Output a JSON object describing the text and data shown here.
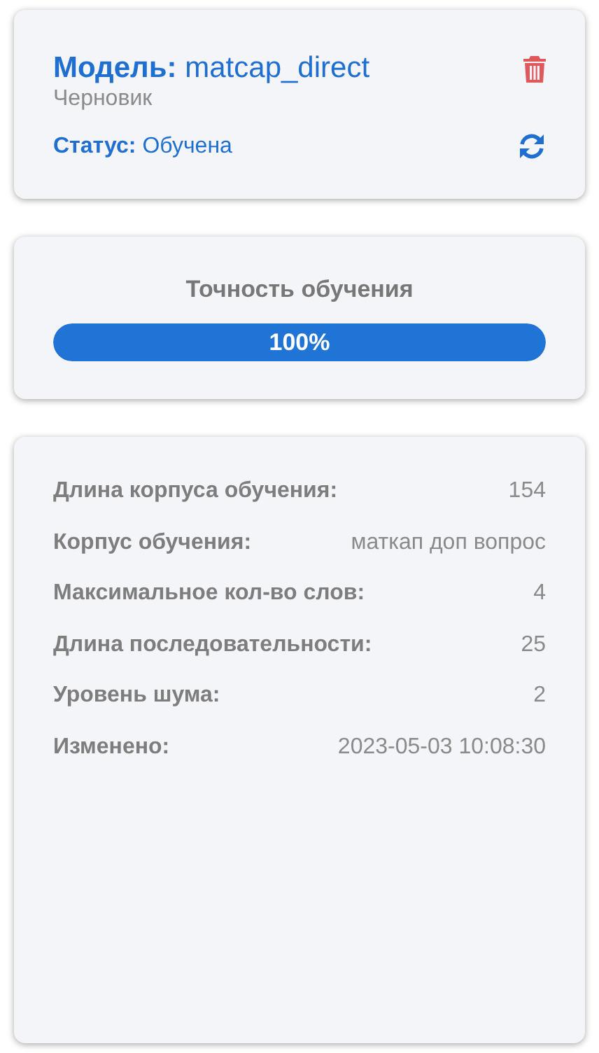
{
  "model_card": {
    "title": "**Модель:** matcap_direct",
    "subtitle": "Черновик",
    "status": "**Статус:** Обучена"
  },
  "training": {
    "title": "Точность обучения",
    "level": 1.0,
    "reading": "100%"
  },
  "details": [
    {
      "label": "Длина корпуса обучения:",
      "value": "154"
    },
    {
      "label": "Корпус обучения:",
      "value": "маткап доп вопрос"
    },
    {
      "label": "Максимальное кол-во слов:",
      "value": "4"
    },
    {
      "label": "Длина последовательности:",
      "value": "25"
    },
    {
      "label": "Уровень шума:",
      "value": "2"
    },
    {
      "label": "Изменено:",
      "value": "2023-05-03 10:08:30"
    }
  ]
}
